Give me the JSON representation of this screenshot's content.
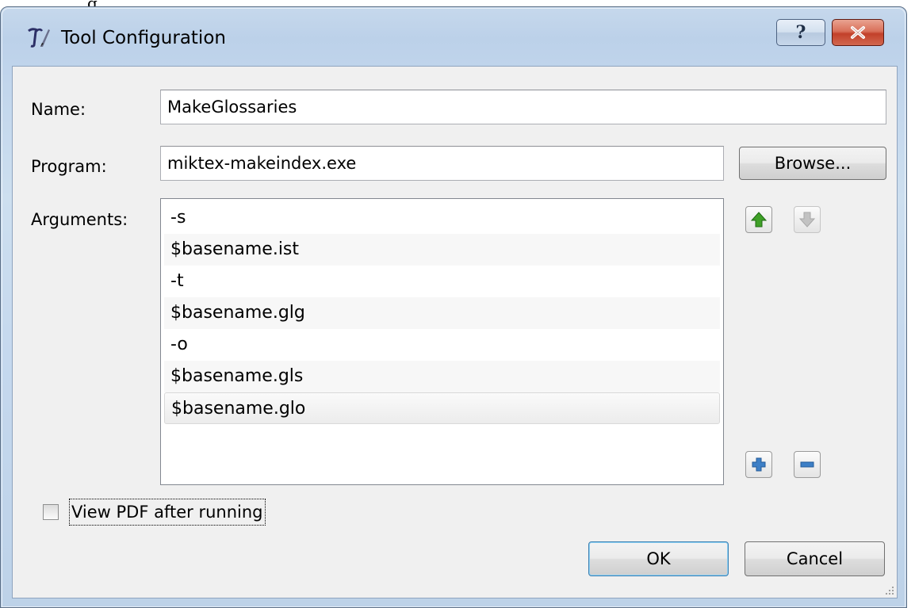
{
  "background_fragment": "g",
  "window": {
    "title": "Tool Configuration",
    "help_glyph": "?",
    "close_glyph": "x"
  },
  "form": {
    "name_label": "Name:",
    "name_value": "MakeGlossaries",
    "program_label": "Program:",
    "program_value": "miktex-makeindex.exe",
    "browse_label": "Browse...",
    "arguments_label": "Arguments:",
    "arguments": [
      "-s",
      "$basename.ist",
      "-t",
      "$basename.glg",
      "-o",
      "$basename.gls",
      "$basename.glo"
    ],
    "selected_argument_index": 6,
    "view_pdf_label": "View PDF after running",
    "view_pdf_checked": false,
    "ok_label": "OK",
    "cancel_label": "Cancel"
  },
  "icons": {
    "app": "texworks-icon",
    "move_up": "arrow-up-icon",
    "move_down": "arrow-down-icon",
    "add": "plus-icon",
    "remove": "minus-icon",
    "resize": "resize-grip-icon"
  },
  "colors": {
    "up_arrow": "#3fa027",
    "down_arrow_disabled": "#c2c2c2",
    "plus_minus": "#3d7fc6",
    "close_red": "#c2402a"
  }
}
